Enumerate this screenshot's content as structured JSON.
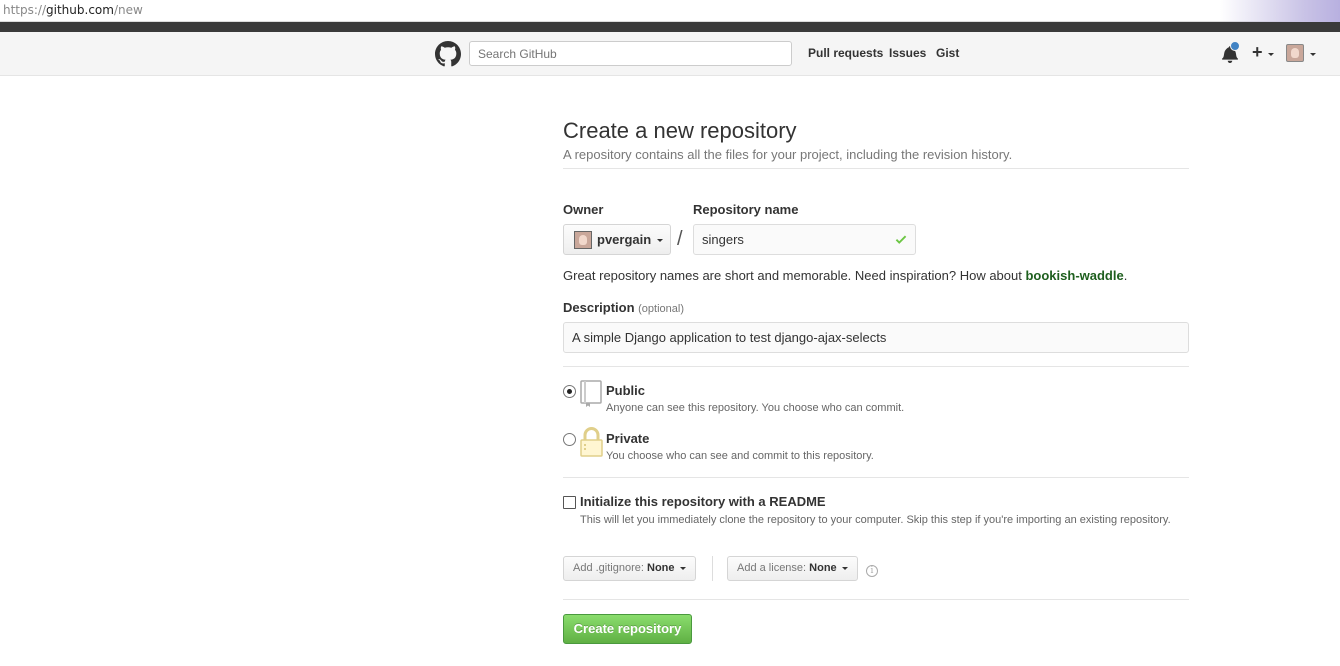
{
  "browser": {
    "url_scheme": "https://",
    "url_host": "github.com",
    "url_path": "/new"
  },
  "header": {
    "search_placeholder": "Search GitHub",
    "nav": [
      "Pull requests",
      "Issues",
      "Gist"
    ],
    "notification_color": "#4183c4"
  },
  "page": {
    "title": "Create a new repository",
    "subtitle": "A repository contains all the files for your project, including the revision history."
  },
  "form": {
    "owner_label": "Owner",
    "owner_value": "pvergain",
    "slash": "/",
    "repo_label": "Repository name",
    "repo_value": "singers",
    "hint_text": "Great repository names are short and memorable. Need inspiration? How about",
    "hint_suggestion": "bookish-waddle",
    "hint_end": ".",
    "description_label": "Description",
    "description_optional": "(optional)",
    "description_value": "A simple Django application to test django-ajax-selects",
    "visibility": {
      "selected": "public",
      "public_title": "Public",
      "public_desc": "Anyone can see this repository. You choose who can commit.",
      "private_title": "Private",
      "private_desc": "You choose who can see and commit to this repository."
    },
    "readme": {
      "checked": false,
      "title": "Initialize this repository with a README",
      "desc": "This will let you immediately clone the repository to your computer. Skip this step if you're importing an existing repository."
    },
    "gitignore_label": "Add .gitignore:",
    "gitignore_value": "None",
    "license_label": "Add a license:",
    "license_value": "None",
    "info_glyph": "i",
    "submit_label": "Create repository"
  }
}
